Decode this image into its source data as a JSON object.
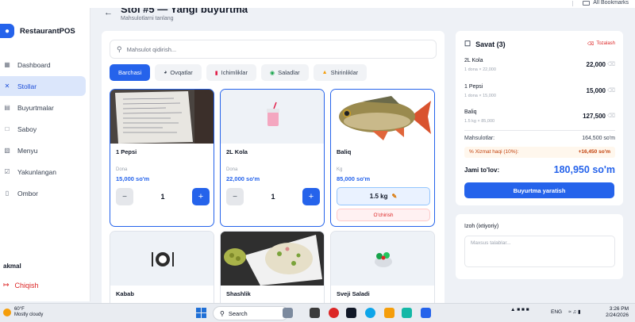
{
  "browser": {
    "bookmarks_label": "All Bookmarks"
  },
  "sidebar": {
    "brand": "RestaurantPOS",
    "items": [
      {
        "label": "Dashboard",
        "icon": "grid-icon"
      },
      {
        "label": "Stollar",
        "icon": "utensils-icon"
      },
      {
        "label": "Buyurtmalar",
        "icon": "document-icon"
      },
      {
        "label": "Saboy",
        "icon": "bag-icon"
      },
      {
        "label": "Menyu",
        "icon": "book-icon"
      },
      {
        "label": "Yakunlangan",
        "icon": "check-square-icon"
      },
      {
        "label": "Ombor",
        "icon": "warehouse-icon"
      }
    ],
    "active_item": "Stollar",
    "user": "akmal",
    "logout": "Chiqish"
  },
  "header": {
    "title": "Stol #5 — Yangi buyurtma",
    "subtitle": "Mahsulotlarni tanlang"
  },
  "products": {
    "search_placeholder": "Mahsulot qidirish...",
    "tabs": [
      {
        "label": "Barchasi",
        "icon": ""
      },
      {
        "label": "Ovqatlar",
        "icon": "plate-icon"
      },
      {
        "label": "Ichimliklar",
        "icon": "drink-icon"
      },
      {
        "label": "Saladlar",
        "icon": "salad-icon"
      },
      {
        "label": "Shirinliklar",
        "icon": "cake-icon"
      }
    ],
    "active_tab": "Barchasi",
    "cards": [
      {
        "name": "1 Pepsi",
        "unit": "Dona",
        "price": "15,000 so'm",
        "qty": "1"
      },
      {
        "name": "2L Kola",
        "unit": "Dona",
        "price": "22,000 so'm",
        "qty": "1"
      },
      {
        "name": "Baliq",
        "unit": "Kg",
        "price": "85,000 so'm",
        "weight": "1.5 kg",
        "delete_label": "O'chirish"
      },
      {
        "name": "Kabab"
      },
      {
        "name": "Shashlik"
      },
      {
        "name": "Svejі Saladi"
      }
    ]
  },
  "cart": {
    "title": "Savat (3)",
    "clear_label": "Tozalash",
    "lines": [
      {
        "name": "2L Kola",
        "detail": "1 dona × 22,000",
        "total": "22,000"
      },
      {
        "name": "1 Pepsi",
        "detail": "1 dona × 15,000",
        "total": "15,000"
      },
      {
        "name": "Baliq",
        "detail": "1.5 kg × 85,000",
        "total": "127,500"
      }
    ],
    "subtotal_label": "Mahsulotlar:",
    "subtotal_value": "164,500 so'm",
    "service_label": "% Xizmat haqi (10%):",
    "service_value": "+16,450 so'm",
    "total_label": "Jami to'lov:",
    "total_value": "180,950 so'm",
    "order_button": "Buyurtma yaratish"
  },
  "notes": {
    "label": "Izoh (ixtiyoriy)",
    "placeholder": "Maxsus talablar..."
  },
  "taskbar": {
    "temp": "60°F",
    "weather": "Mostly cloudy",
    "search": "Search",
    "lang": "ENG",
    "time": "3:26 PM",
    "date": "2/24/2026"
  }
}
